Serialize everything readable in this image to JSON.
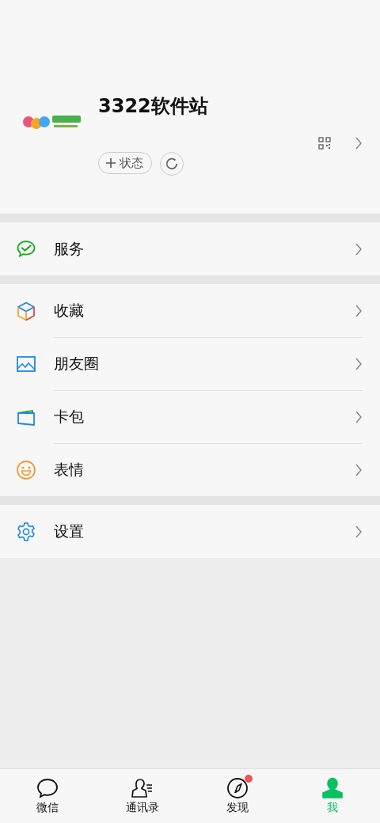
{
  "profile": {
    "kind": "picture",
    "name": "3322软件站",
    "status_button": "状态"
  },
  "menu_groups": [
    [
      {
        "kind": "service",
        "label": "服务"
      }
    ],
    [
      {
        "kind": "favorites",
        "label": "收藏"
      },
      {
        "kind": "moments",
        "label": "朋友圈"
      },
      {
        "kind": "cards",
        "label": "卡包"
      },
      {
        "kind": "stickers",
        "label": "表情"
      }
    ],
    [
      {
        "kind": "settings",
        "label": "设置"
      }
    ]
  ],
  "tabs": [
    {
      "kind": "chats",
      "label": "微信",
      "selected": false,
      "badge": false
    },
    {
      "kind": "contacts",
      "label": "通讯录",
      "selected": false,
      "badge": false
    },
    {
      "kind": "discover",
      "label": "发现",
      "selected": false,
      "badge": true
    },
    {
      "kind": "me",
      "label": "我",
      "selected": true,
      "badge": false
    }
  ]
}
